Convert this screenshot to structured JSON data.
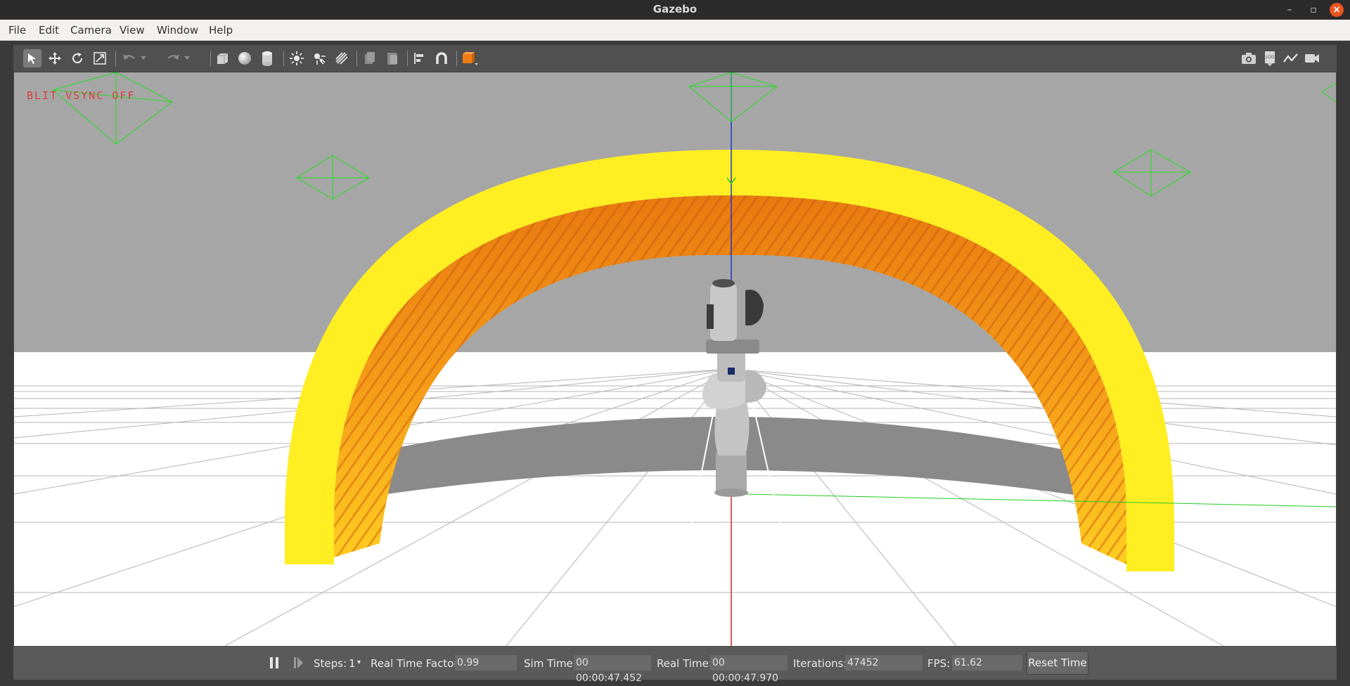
{
  "window": {
    "title": "Gazebo"
  },
  "menu": [
    "File",
    "Edit",
    "Camera",
    "View",
    "Window",
    "Help"
  ],
  "toolbar": {
    "tools": [
      "select-tool",
      "translate-tool",
      "rotate-tool",
      "scale-tool",
      "undo",
      "redo",
      "box-shape",
      "sphere-shape",
      "cylinder-shape",
      "point-light",
      "spot-light",
      "directional-light",
      "copy",
      "paste",
      "align",
      "snap",
      "color-change"
    ],
    "right_tools": [
      "screenshot",
      "log",
      "plot",
      "video-record"
    ]
  },
  "viewport": {
    "overlay_text": "BLIT   VSYNC OFF",
    "colors": {
      "sky": "#a6a6a6",
      "ground": "#ffffff",
      "arch": "#ffee22",
      "arch_inner": "#f08a10",
      "axis_z": "#2233cc",
      "axis_x": "#dd2222",
      "axis_y": "#22cc22"
    }
  },
  "statusbar": {
    "steps_label": "Steps:",
    "steps_value": "1",
    "rtf_label": "Real Time Factor:",
    "rtf_value": "0.99",
    "sim_label": "Sim Time:",
    "sim_value": "00 00:00:47.452",
    "real_label": "Real Time:",
    "real_value": "00 00:00:47.970",
    "iter_label": "Iterations:",
    "iter_value": "47452",
    "fps_label": "FPS:",
    "fps_value": "61.62",
    "reset_label": "Reset Time"
  }
}
